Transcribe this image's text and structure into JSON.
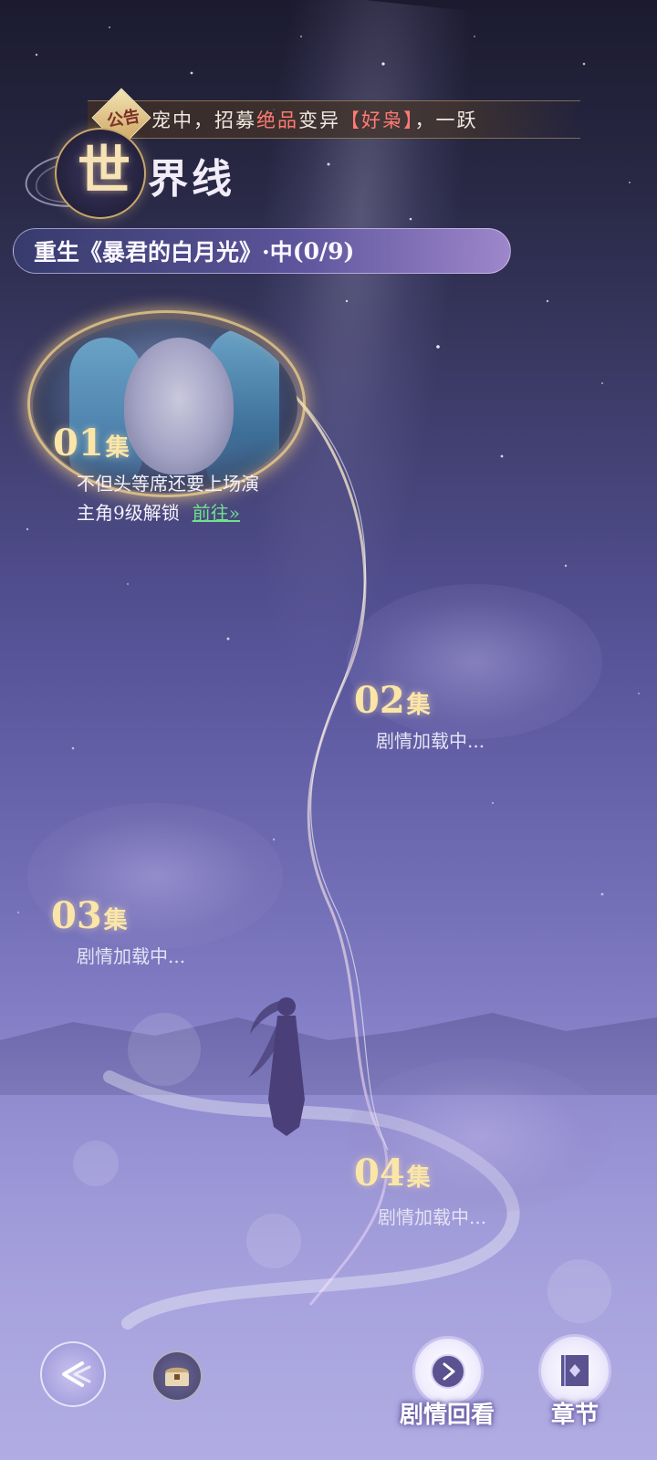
{
  "announcement": {
    "badge": "公告",
    "text_before": "宠中，招募",
    "text_highlight_1": "绝品",
    "text_middle": "变异",
    "text_highlight_2": "【好枭】",
    "text_after": "，一跃"
  },
  "title": {
    "first_char": "世",
    "rest": "界线"
  },
  "chapter": {
    "name": "重生《暴君的白月光》",
    "status": "·中",
    "progress": "(0/9)"
  },
  "episodes": [
    {
      "number": "01",
      "unit": "集",
      "subtitle": "不但头等席还要上场演",
      "unlock_text": "主角9级解锁",
      "goto_label": "前往»"
    },
    {
      "number": "02",
      "unit": "集",
      "status": "剧情加载中..."
    },
    {
      "number": "03",
      "unit": "集",
      "status": "剧情加载中..."
    },
    {
      "number": "04",
      "unit": "集",
      "status": "剧情加载中..."
    }
  ],
  "bottom_bar": {
    "back_icon": "back-arrow-icon",
    "mail_icon": "treasure-chest-icon",
    "replay_label": "剧情回看",
    "chapters_label": "章节"
  },
  "colors": {
    "accent_gold": "#fbe6a8",
    "goto_green": "#6fe38a",
    "highlight_red": "#ff7a72"
  }
}
